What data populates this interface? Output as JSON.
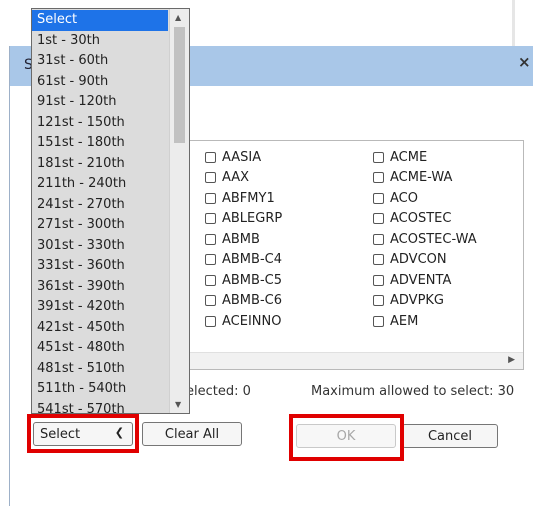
{
  "dialog": {
    "title_fragment": "S",
    "close_label": "×"
  },
  "listbox": {
    "options": [
      "Select",
      "1st - 30th",
      "31st - 60th",
      "61st - 90th",
      "91st - 120th",
      "121st - 150th",
      "151st - 180th",
      "181st - 210th",
      "211th - 240th",
      "241st - 270th",
      "271st - 300th",
      "301st - 330th",
      "331st - 360th",
      "361st - 390th",
      "391st - 420th",
      "421st - 450th",
      "451st - 480th",
      "481st - 510th",
      "511th - 540th",
      "541st - 570th"
    ],
    "selected": "Select"
  },
  "checkboxes": {
    "col1": [
      "AASIA",
      "AAX",
      "ABFMY1",
      "ABLEGRP",
      "ABMB",
      "ABMB-C4",
      "ABMB-C5",
      "ABMB-C6",
      "ACEINNO"
    ],
    "col2": [
      "ACME",
      "ACME-WA",
      "ACO",
      "ACOSTEC",
      "ACOSTEC-WA",
      "ADVCON",
      "ADVENTA",
      "ADVPKG",
      "AEM"
    ]
  },
  "status": {
    "selected_text": "elected: 0",
    "max_text": "Maximum allowed to select: 30"
  },
  "buttons": {
    "select_label": "Select",
    "clear_all": "Clear All",
    "ok": "OK",
    "cancel": "Cancel"
  },
  "colors": {
    "highlight": "#e00000",
    "selected_option": "#1e73e8",
    "title_bar": "#a9c7e8"
  }
}
